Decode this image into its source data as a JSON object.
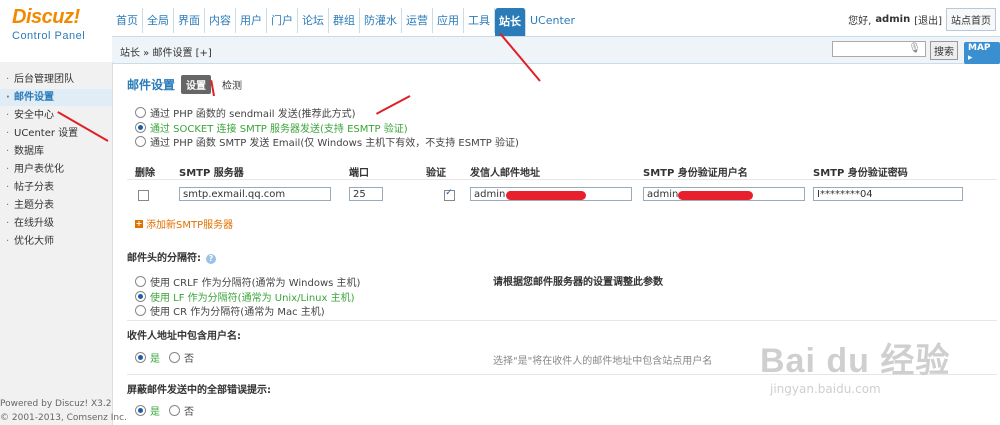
{
  "logo": {
    "title": "Discuz!",
    "subtitle": "Control Panel"
  },
  "topnav": [
    "首页",
    "全局",
    "界面",
    "内容",
    "用户",
    "门户",
    "论坛",
    "群组",
    "防灌水",
    "运营",
    "应用",
    "工具",
    "站长",
    "UCenter"
  ],
  "topnav_active": "站长",
  "user": {
    "greeting_prefix": "您好,",
    "name": "admin",
    "logout": "[退出]",
    "site_home": "站点首页"
  },
  "breadcrumb": "站长 » 邮件设置  [+]",
  "search": {
    "button": "搜索",
    "map": "MAP"
  },
  "sidebar": {
    "items": [
      "后台管理团队",
      "邮件设置",
      "安全中心",
      "UCenter 设置",
      "数据库",
      "用户表优化",
      "帖子分表",
      "主题分表",
      "在线升级",
      "优化大师"
    ],
    "active": "邮件设置",
    "powered": "Powered by Discuz! X3.2",
    "copyright": "© 2001-2013, Comsenz Inc."
  },
  "page": {
    "title": "邮件设置",
    "tabs": [
      "设置",
      "检测"
    ],
    "active_tab": "设置"
  },
  "send_methods": {
    "options": [
      "通过 PHP 函数的 sendmail 发送(推荐此方式)",
      "通过 SOCKET 连接 SMTP 服务器发送(支持 ESMTP 验证)",
      "通过 PHP 函数 SMTP 发送 Email(仅 Windows 主机下有效，不支持 ESMTP 验证)"
    ],
    "selected_index": 1
  },
  "smtp_table": {
    "headers": [
      "删除",
      "SMTP 服务器",
      "端口",
      "验证",
      "发信人邮件地址",
      "SMTP 身份验证用户名",
      "SMTP 身份验证密码"
    ],
    "row": {
      "delete": false,
      "server": "smtp.exmail.qq.com",
      "port": "25",
      "auth": true,
      "from": "admin",
      "username": "admin",
      "password": "I********04"
    },
    "add_label": "添加新SMTP服务器"
  },
  "separator": {
    "title": "邮件头的分隔符:",
    "options": [
      "使用 CRLF 作为分隔符(通常为 Windows 主机)",
      "使用 LF 作为分隔符(通常为 Unix/Linux 主机)",
      "使用 CR 作为分隔符(通常为 Mac 主机)"
    ],
    "selected_index": 1,
    "hint": "请根据您邮件服务器的设置调整此参数"
  },
  "include_username": {
    "title": "收件人地址中包含用户名:",
    "yes": "是",
    "no": "否",
    "selected": "是",
    "hint": "选择\"是\"将在收件人的邮件地址中包含站点用户名"
  },
  "mask_errors": {
    "title": "屏蔽邮件发送中的全部错误提示:",
    "yes": "是",
    "no": "否",
    "selected": "是"
  },
  "watermark": {
    "main": "Bai du 经验",
    "sub": "jingyan.baidu.com"
  },
  "colors": {
    "accent": "#2b7bb9",
    "logo_orange": "#f18a00",
    "selected_green": "#3aa53a",
    "annotation_red": "#e01f26"
  }
}
